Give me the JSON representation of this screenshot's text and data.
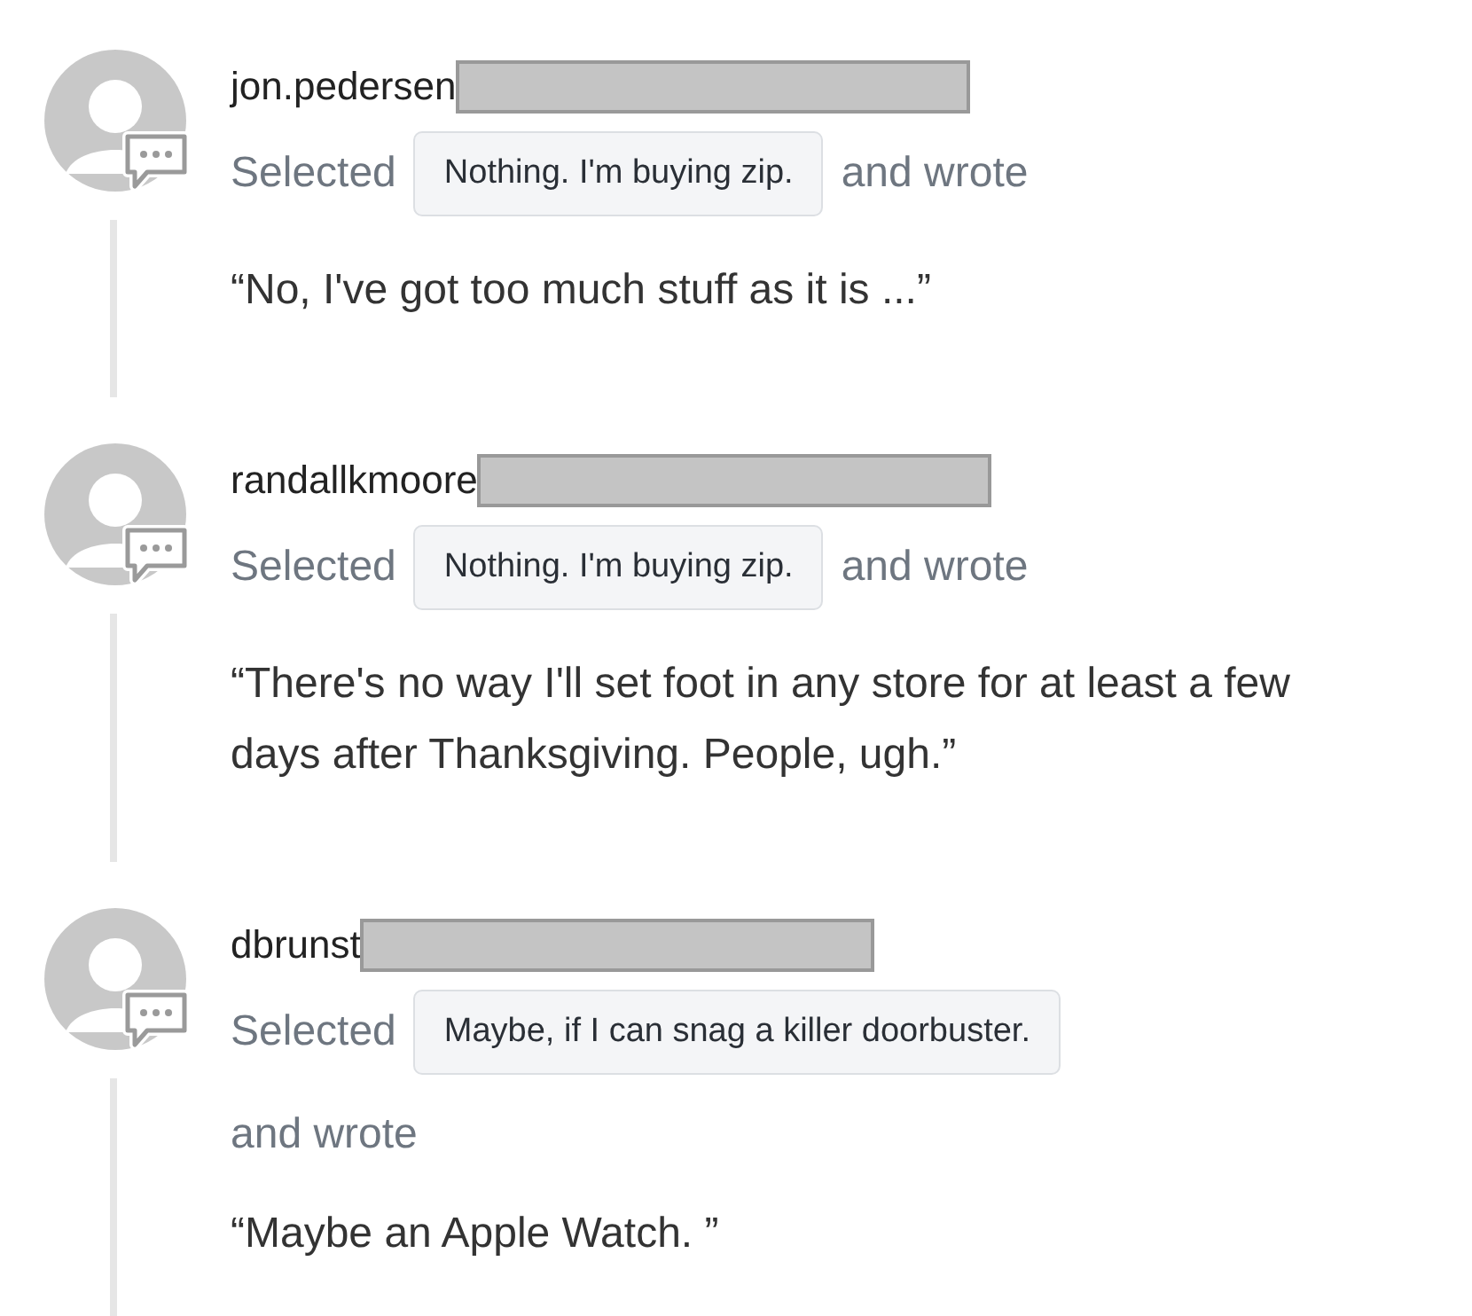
{
  "responses": [
    {
      "username": "jon.pedersen",
      "selected_label": "Selected",
      "choice": "Nothing. I'm buying zip.",
      "wrote_label": "and wrote",
      "quote": "“No, I've got too much stuff as it is ...”",
      "wrap_wrote": false
    },
    {
      "username": "randallkmoore",
      "selected_label": "Selected",
      "choice": "Nothing. I'm buying zip.",
      "wrote_label": "and wrote",
      "quote": "“There's no way I'll set foot in any store for at least a few days after Thanksgiving. People, ugh.”",
      "wrap_wrote": false
    },
    {
      "username": "dbrunst",
      "selected_label": "Selected",
      "choice": "Maybe, if I can snag a killer doorbuster.",
      "wrote_label": "and wrote",
      "quote": "“Maybe an Apple Watch. ”",
      "wrap_wrote": true
    }
  ]
}
